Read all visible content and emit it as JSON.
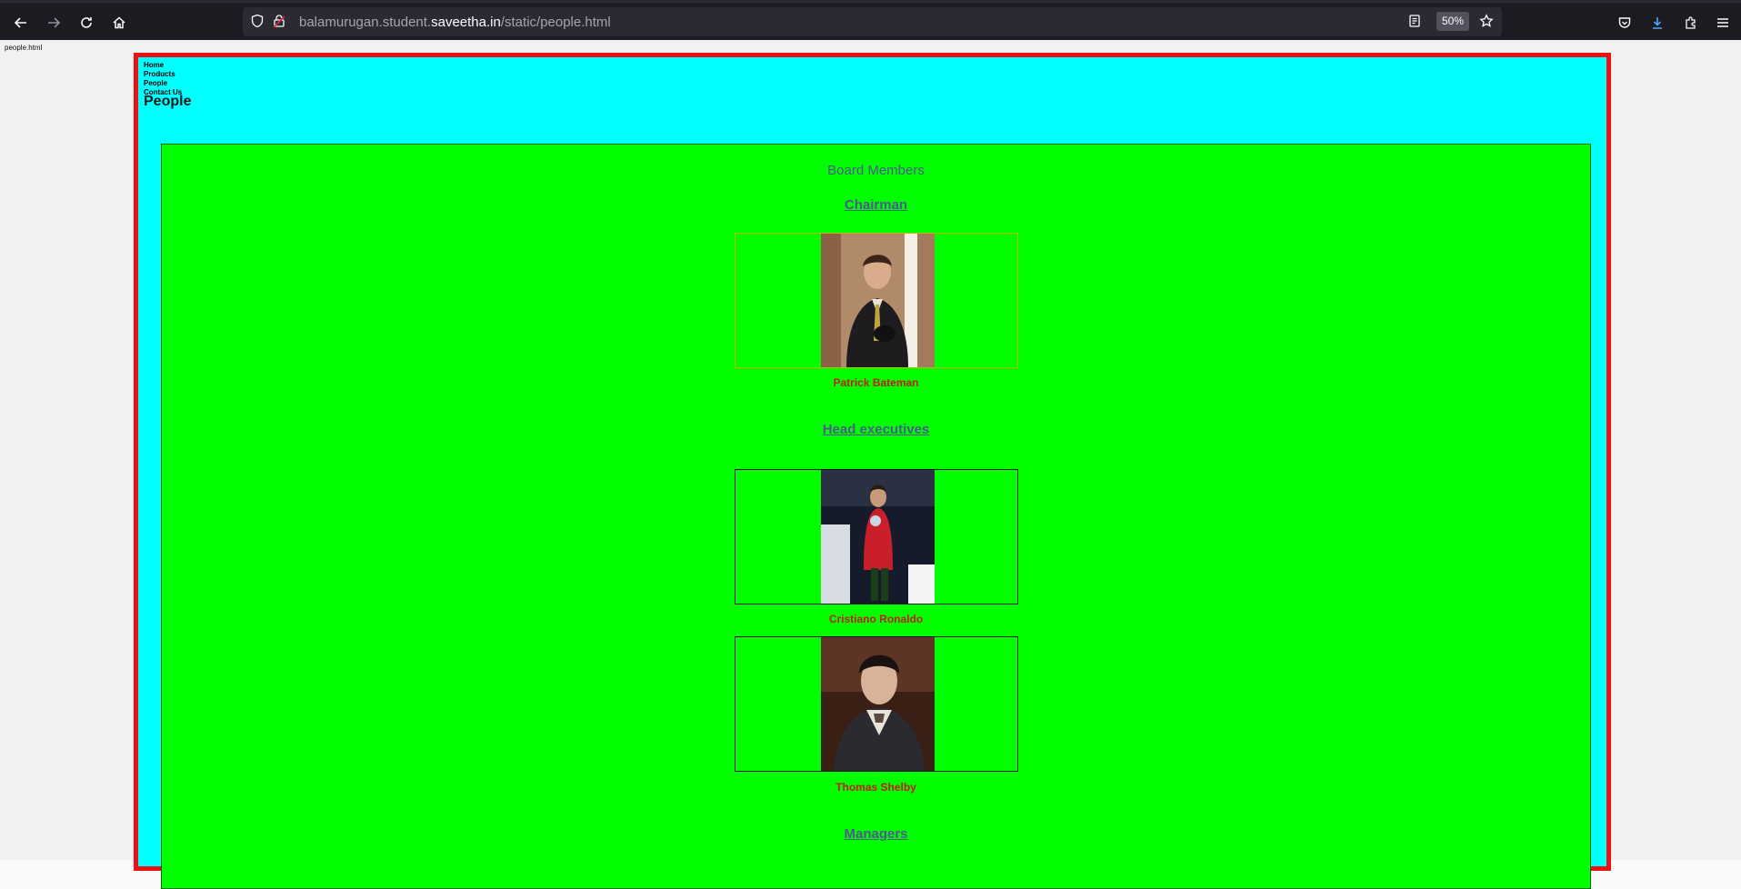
{
  "browser": {
    "url_scheme_host_prefix": "balamurugan.student.",
    "url_host_main": "saveetha.in",
    "url_path": "/static/people.html",
    "zoom": "50%"
  },
  "page": {
    "file_label": "people.html",
    "menu": [
      "Home",
      "Products",
      "People",
      "Contact Us"
    ],
    "heading": "People",
    "board_title": "Board Members",
    "sections": {
      "chairman": "Chairman",
      "head_executives": "Head executives",
      "managers": "Managers"
    },
    "people": {
      "chairman": "Patrick Bateman",
      "exec1": "Cristiano Ronaldo",
      "exec2": "Thomas Shelby"
    }
  },
  "colors": {
    "outer_bg": "#00ffff",
    "outer_border": "#ee1111",
    "inner_bg": "#00ff00",
    "name_color": "#c81919"
  }
}
